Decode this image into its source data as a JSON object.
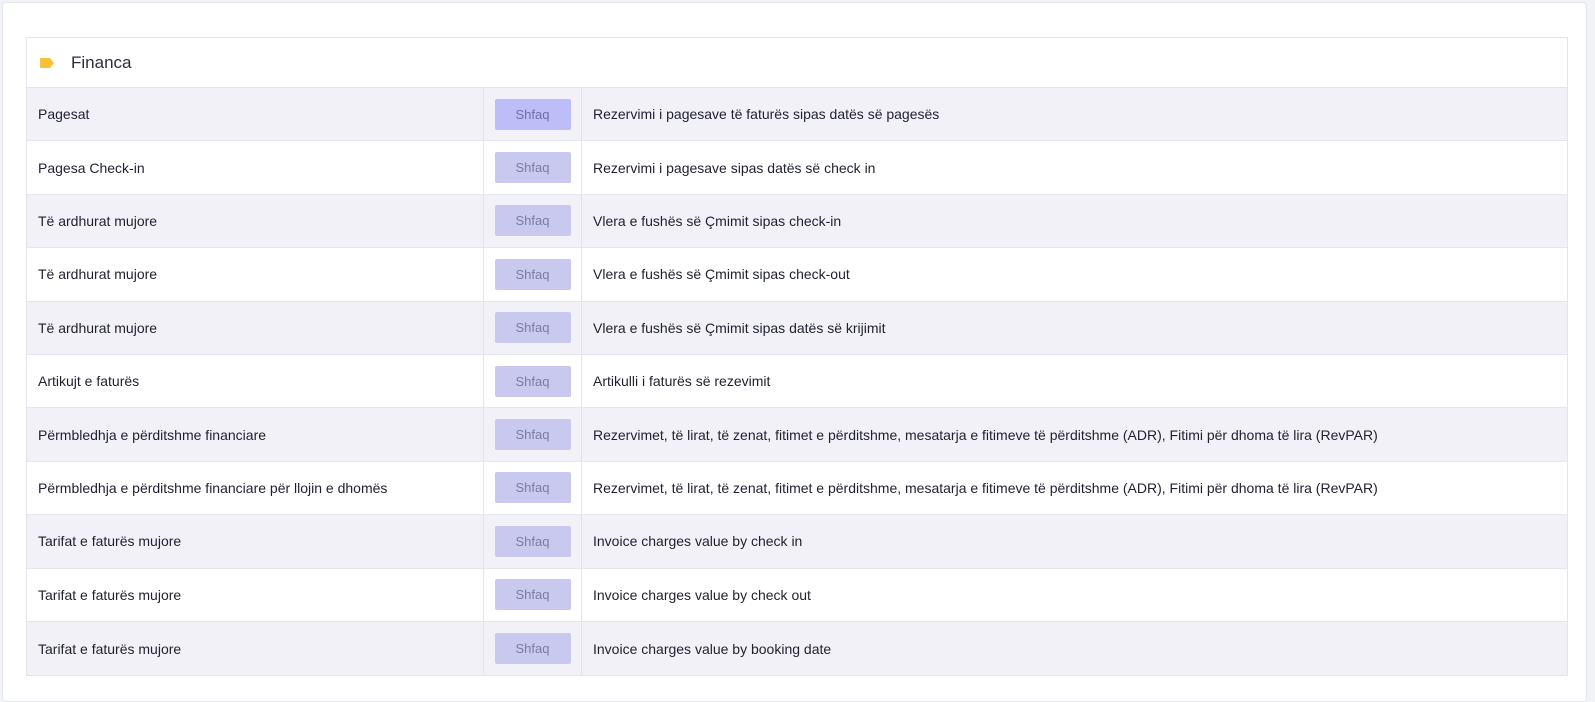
{
  "panel": {
    "title": "Financa",
    "accent_color": "#f7c23a"
  },
  "reports": [
    {
      "name": "Pagesat",
      "button": "Shfaq",
      "description": "Rezervimi i pagesave të faturës sipas datës së pagesës"
    },
    {
      "name": "Pagesa Check-in",
      "button": "Shfaq",
      "description": "Rezervimi i pagesave sipas datës së check in"
    },
    {
      "name": "Të ardhurat mujore",
      "button": "Shfaq",
      "description": "Vlera e fushës së Çmimit sipas check-in"
    },
    {
      "name": "Të ardhurat mujore",
      "button": "Shfaq",
      "description": "Vlera e fushës së Çmimit sipas check-out"
    },
    {
      "name": "Të ardhurat mujore",
      "button": "Shfaq",
      "description": "Vlera e fushës së Çmimit sipas datës së krijimit"
    },
    {
      "name": "Artikujt e faturës",
      "button": "Shfaq",
      "description": "Artikulli i faturës së rezevimit"
    },
    {
      "name": "Përmbledhja e përditshme financiare",
      "button": "Shfaq",
      "description": "Rezervimet, të lirat, të zenat, fitimet e përditshme, mesatarja e fitimeve të përditshme (ADR), Fitimi për dhoma të lira (RevPAR)"
    },
    {
      "name": "Përmbledhja e përditshme financiare për llojin e dhomës",
      "button": "Shfaq",
      "description": "Rezervimet, të lirat, të zenat, fitimet e përditshme, mesatarja e fitimeve të përditshme (ADR), Fitimi për dhoma të lira (RevPAR)"
    },
    {
      "name": "Tarifat e faturës mujore",
      "button": "Shfaq",
      "description": "Invoice charges value by check in"
    },
    {
      "name": "Tarifat e faturës mujore",
      "button": "Shfaq",
      "description": "Invoice charges value by check out"
    },
    {
      "name": "Tarifat e faturës mujore",
      "button": "Shfaq",
      "description": "Invoice charges value by booking date"
    }
  ]
}
